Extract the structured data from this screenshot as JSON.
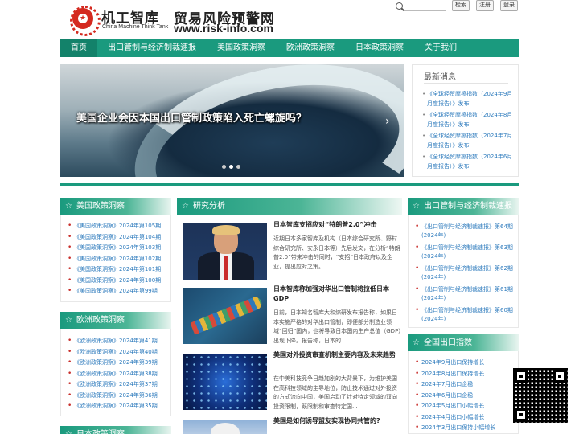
{
  "header": {
    "logo_cn": "机工智库",
    "logo_en": "China Machine Think Tank",
    "site_title": "贸易风险预警网",
    "site_url": "www.risk-info.com",
    "search_placeholder": "",
    "search_button": "检索",
    "register_button": "注册",
    "login_button": "登录"
  },
  "nav": {
    "items": [
      {
        "label": "首页",
        "active": true
      },
      {
        "label": "出口管制与经济制裁速报"
      },
      {
        "label": "美国政策洞察"
      },
      {
        "label": "欧洲政策洞察"
      },
      {
        "label": "日本政策洞察"
      },
      {
        "label": "关于我们"
      }
    ]
  },
  "banner": {
    "caption": "美国企业会因本国出口管制政策陷入死亡螺旋吗？",
    "next_arrow": "›"
  },
  "latest": {
    "title": "最新消息",
    "items": [
      "《全球经贸摩擦指数（2024年9月月度报告）》发布",
      "《全球经贸摩擦指数（2024年8月月度报告）》发布",
      "《全球经贸摩擦指数（2024年7月月度报告）》发布",
      "《全球经贸摩擦指数（2024年6月月度报告）》发布"
    ]
  },
  "us_panel": {
    "title": "美国政策洞察",
    "items": [
      "《美国政策洞察》2024年第105期",
      "《美国政策洞察》2024年第104期",
      "《美国政策洞察》2024年第103期",
      "《美国政策洞察》2024年第102期",
      "《美国政策洞察》2024年第101期",
      "《美国政策洞察》2024年第100期",
      "《美国政策洞察》2024年第99期"
    ]
  },
  "eu_panel": {
    "title": "欧洲政策洞察",
    "items": [
      "《欧洲政策洞察》2024年第41期",
      "《欧洲政策洞察》2024年第40期",
      "《欧洲政策洞察》2024年第39期",
      "《欧洲政策洞察》2024年第38期",
      "《欧洲政策洞察》2024年第37期",
      "《欧洲政策洞察》2024年第36期",
      "《欧洲政策洞察》2024年第35期"
    ]
  },
  "jp_panel": {
    "title": "日本政策洞察"
  },
  "research": {
    "title": "研究分析",
    "articles": [
      {
        "title": "日本智库支招应对“特朗普2.0”冲击",
        "desc": "近期日本多家智库及机构（日本综合研究所、野村综合研究所、安永日本等）先后发文，在分析“特朗普2.0”带来冲击的同时，“支招”日本政府以及企业，提出应对之策。"
      },
      {
        "title": "日本智库称加强对华出口管制将拉低日本GDP",
        "desc": "日前，日本知名智库大和综研发布报告称，如果日本实施严格的对华出口管制，即便部分制造业领域“回归”国内，也将导致日本国内生产总值（GDP）出现下降。报告称，日本的..."
      },
      {
        "title": "美国对外投资审查机制主要内容及未来趋势",
        "desc": "在中美科技竞争日趋加剧的大背景下，为维护美国在高科技领域的主导地位，防止技术通过对外投资的方式流向中国，美国启动了针对特定领域的双向投资限制，既限制和审查特定国..."
      },
      {
        "title": "美国是如何诱导盟友实现协同共管的?",
        "desc": ""
      }
    ]
  },
  "ec_panel": {
    "title": "出口管制与经济制裁速报",
    "items": [
      "《出口管制与经济制裁速报》第64期(2024年)",
      "《出口管制与经济制裁速报》第63期(2024年)",
      "《出口管制与经济制裁速报》第62期(2024年)",
      "《出口管制与经济制裁速报》第61期(2024年)",
      "《出口管制与经济制裁速报》第60期(2024年)"
    ]
  },
  "export_panel": {
    "title": "全国出口指数",
    "items": [
      "2024年9月出口保持增长",
      "2024年8月出口保持增长",
      "2024年7月出口企稳",
      "2024年6月出口企稳",
      "2024年5月出口小幅增长",
      "2024年4月出口小幅增长",
      "2024年3月出口保持小幅增长"
    ]
  },
  "colors": {
    "primary": "#1a9a7e",
    "link": "#2e7bbd",
    "bullet": "#c9302c"
  }
}
